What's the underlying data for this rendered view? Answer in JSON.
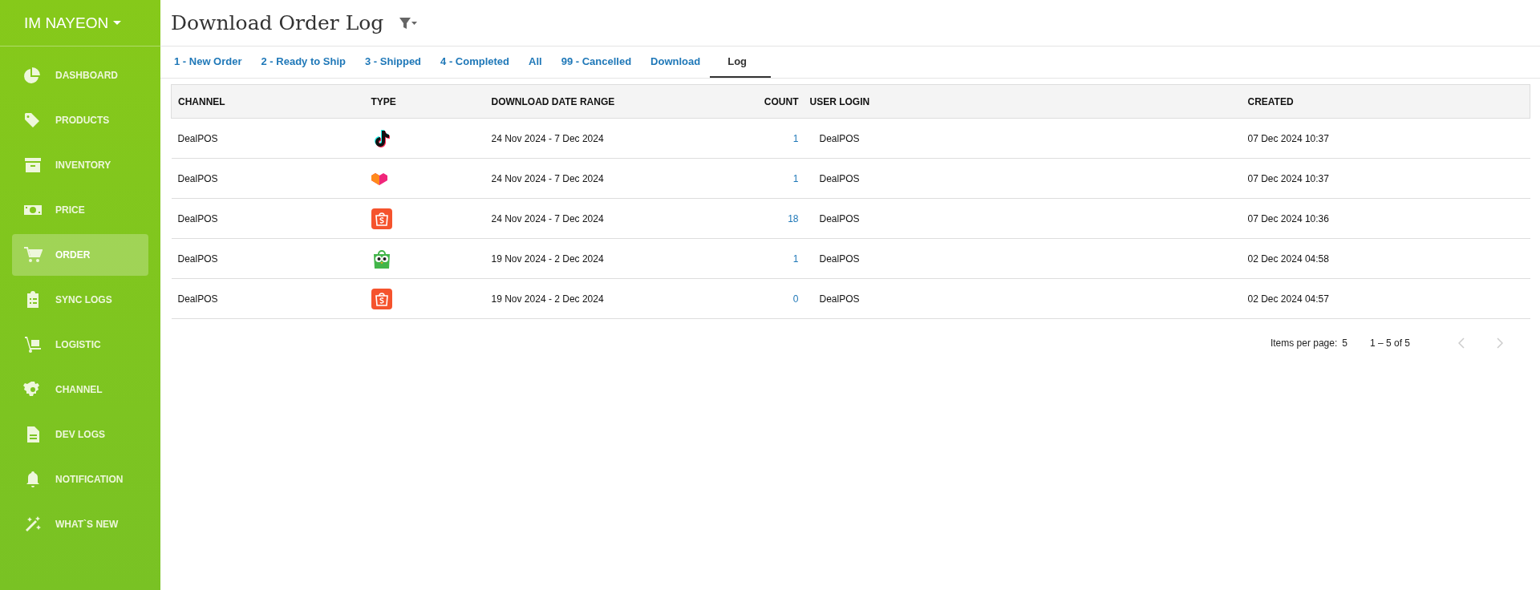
{
  "sidebar": {
    "account": "IM NAYEON",
    "items": [
      {
        "label": "DASHBOARD",
        "selected": false
      },
      {
        "label": "PRODUCTS",
        "selected": false
      },
      {
        "label": "INVENTORY",
        "selected": false
      },
      {
        "label": "PRICE",
        "selected": false
      },
      {
        "label": "ORDER",
        "selected": true
      },
      {
        "label": "SYNC LOGS",
        "selected": false
      },
      {
        "label": "LOGISTIC",
        "selected": false
      },
      {
        "label": "CHANNEL",
        "selected": false
      },
      {
        "label": "DEV LOGS",
        "selected": false
      },
      {
        "label": "NOTIFICATION",
        "selected": false
      },
      {
        "label": "WHAT`S NEW",
        "selected": false
      }
    ]
  },
  "header": {
    "title": "Download Order Log"
  },
  "tabs": [
    {
      "label": "1 - New Order",
      "selected": false
    },
    {
      "label": "2 - Ready to Ship",
      "selected": false
    },
    {
      "label": "3 - Shipped",
      "selected": false
    },
    {
      "label": "4 - Completed",
      "selected": false
    },
    {
      "label": "All",
      "selected": false
    },
    {
      "label": "99 - Cancelled",
      "selected": false
    },
    {
      "label": "Download",
      "selected": false
    },
    {
      "label": "Log",
      "selected": true
    }
  ],
  "table": {
    "columns": [
      "CHANNEL",
      "TYPE",
      "DOWNLOAD DATE RANGE",
      "COUNT",
      "USER LOGIN",
      "CREATED"
    ],
    "rows": [
      {
        "channel": "DealPOS",
        "kind": "note",
        "date_range": "24 Nov 2024 - 7 Dec 2024",
        "count": "1",
        "user_login": "DealPOS",
        "created": "07 Dec 2024 10:37"
      },
      {
        "channel": "DealPOS",
        "kind": "heart",
        "date_range": "24 Nov 2024 - 7 Dec 2024",
        "count": "1",
        "user_login": "DealPOS",
        "created": "07 Dec 2024 10:37"
      },
      {
        "channel": "DealPOS",
        "kind": "bag",
        "date_range": "24 Nov 2024 - 7 Dec 2024",
        "count": "18",
        "user_login": "DealPOS",
        "created": "07 Dec 2024 10:36"
      },
      {
        "channel": "DealPOS",
        "kind": "owl",
        "date_range": "19 Nov 2024 - 2 Dec 2024",
        "count": "1",
        "user_login": "DealPOS",
        "created": "02 Dec 2024 04:58"
      },
      {
        "channel": "DealPOS",
        "kind": "bag",
        "date_range": "19 Nov 2024 - 2 Dec 2024",
        "count": "0",
        "user_login": "DealPOS",
        "created": "02 Dec 2024 04:57"
      }
    ]
  },
  "pagination": {
    "items_per_page_label": "Items per page:",
    "items_per_page": "5",
    "range": "1 – 5 of 5",
    "prev_disabled": true,
    "next_disabled": true
  }
}
